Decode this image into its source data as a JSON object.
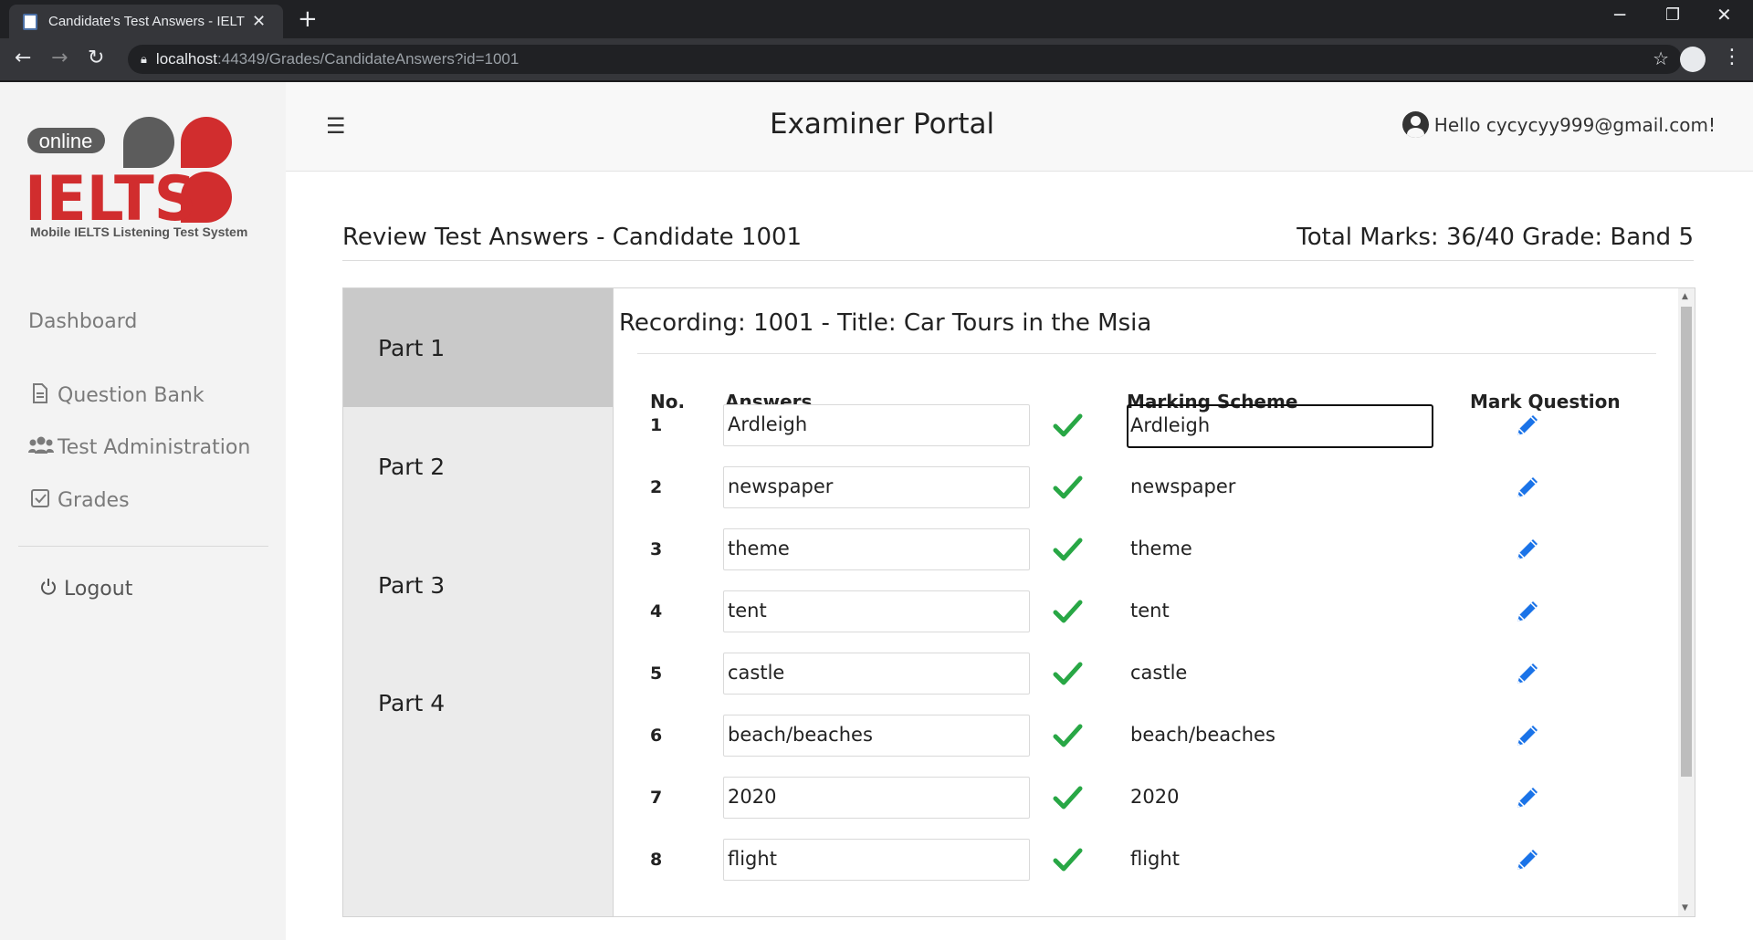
{
  "browser": {
    "tab_title": "Candidate's Test Answers - IELTS",
    "url_host": "localhost",
    "url_path": ":44349/Grades/CandidateAnswers?id=1001"
  },
  "logo": {
    "badge": "online",
    "brand": "IELTS",
    "subtitle": "Mobile IELTS Listening Test System"
  },
  "sidebar": {
    "items": [
      {
        "label": "Dashboard",
        "icon": "none"
      },
      {
        "label": "Question Bank",
        "icon": "document-icon"
      },
      {
        "label": "Test Administration",
        "icon": "users-icon"
      },
      {
        "label": "Grades",
        "icon": "checkbox-icon"
      }
    ],
    "logout": "Logout"
  },
  "header": {
    "title": "Examiner Portal",
    "greeting": "Hello cycycyy999@gmail.com!"
  },
  "review": {
    "title": "Review Test Answers - Candidate 1001",
    "total": "Total Marks: 36/40 Grade: Band 5"
  },
  "parts": [
    "Part 1",
    "Part 2",
    "Part 3",
    "Part 4"
  ],
  "recording": "Recording: 1001 - Title: Car Tours in the Msia",
  "columns": {
    "no": "No.",
    "answers": "Answers",
    "scheme": "Marking Scheme",
    "mark": "Mark Question"
  },
  "rows": [
    {
      "no": "1",
      "answer": "Ardleigh",
      "scheme": "Ardleigh"
    },
    {
      "no": "2",
      "answer": "newspaper",
      "scheme": "newspaper"
    },
    {
      "no": "3",
      "answer": "theme",
      "scheme": "theme"
    },
    {
      "no": "4",
      "answer": "tent",
      "scheme": "tent"
    },
    {
      "no": "5",
      "answer": "castle",
      "scheme": "castle"
    },
    {
      "no": "6",
      "answer": "beach/beaches",
      "scheme": "beach/beaches"
    },
    {
      "no": "7",
      "answer": "2020",
      "scheme": "2020"
    },
    {
      "no": "8",
      "answer": "flight",
      "scheme": "flight"
    }
  ],
  "colors": {
    "check": "#28a745",
    "pencil": "#1a73e8",
    "logo_red": "#d12d2e",
    "logo_gray": "#5c5c5c"
  }
}
